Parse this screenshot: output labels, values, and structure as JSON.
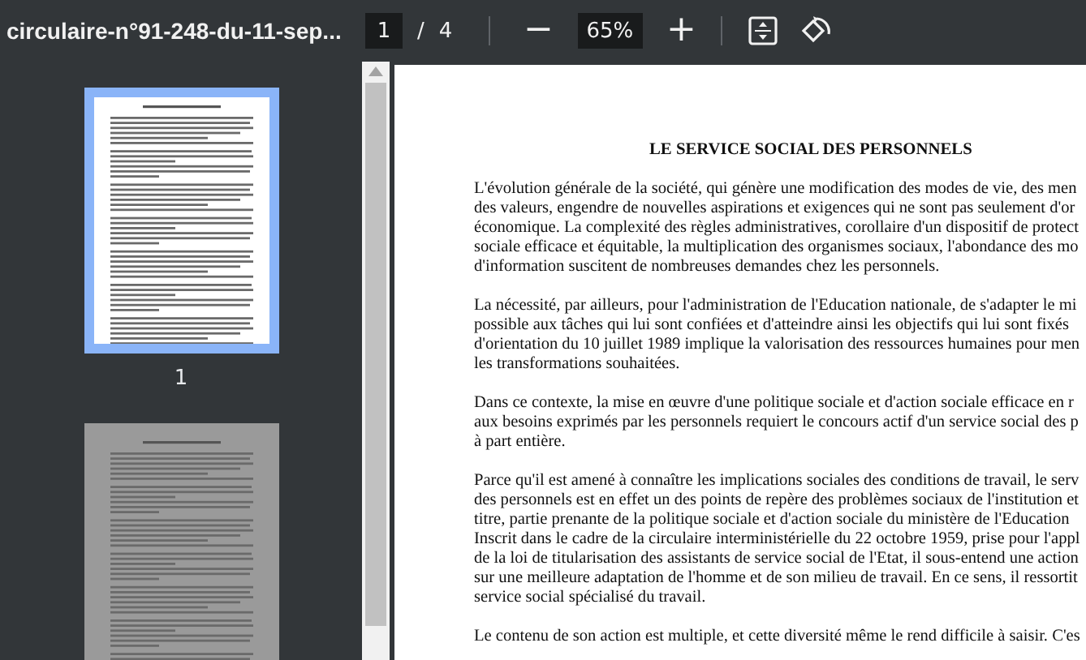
{
  "toolbar": {
    "title": "circulaire-n°91-248-du-11-sep...",
    "page_input": "1",
    "page_separator": "/",
    "page_count": "4",
    "zoom_out": "−",
    "zoom_value": "65%",
    "zoom_in": "+"
  },
  "thumbnails": [
    {
      "label": "1",
      "selected": true
    },
    {
      "selected": false
    }
  ],
  "document": {
    "heading": "LE SERVICE SOCIAL DES PERSONNELS",
    "paragraphs": [
      {
        "lines": [
          "L'évolution générale de la société, qui génère une modification des modes de vie, des men",
          "des valeurs, engendre de nouvelles aspirations et exigences qui ne sont pas seulement d'or",
          "économique. La complexité des règles administratives, corollaire d'un dispositif de protect",
          "sociale efficace et équitable, la multiplication des organismes sociaux, l'abondance des mo",
          "d'information suscitent de nombreuses demandes chez les personnels."
        ]
      },
      {
        "lines": [
          "La nécessité, par ailleurs, pour l'administration de l'Education nationale, de s'adapter le mi",
          "possible aux tâches qui lui sont confiées et d'atteindre ainsi les objectifs qui lui sont fixés",
          "d'orientation du 10 juillet 1989 implique la valorisation des ressources humaines pour men",
          "les transformations souhaitées."
        ]
      },
      {
        "lines": [
          "Dans ce contexte, la mise en œuvre d'une politique sociale et d'action sociale efficace en r",
          "aux besoins exprimés par les personnels requiert le concours actif d'un service social des p",
          "à part entière."
        ]
      },
      {
        "lines": [
          "Parce qu'il est amené à connaître les implications sociales des conditions de travail, le serv",
          "des personnels est en effet un des points de repère des problèmes sociaux de l'institution et",
          "titre, partie prenante de la politique sociale et d'action sociale du ministère de l'Education",
          "Inscrit dans le cadre de la circulaire interministérielle du 22 octobre 1959, prise pour l'appl",
          "de la loi de titularisation des assistants de service social de l'Etat, il sous-entend une action",
          "sur une meilleure adaptation de l'homme et de son milieu de travail. En ce sens, il ressortit",
          "service social spécialisé du travail."
        ]
      },
      {
        "lines": [
          "Le contenu de son action est multiple, et cette diversité même le rend difficile à saisir. C'es"
        ]
      }
    ]
  }
}
